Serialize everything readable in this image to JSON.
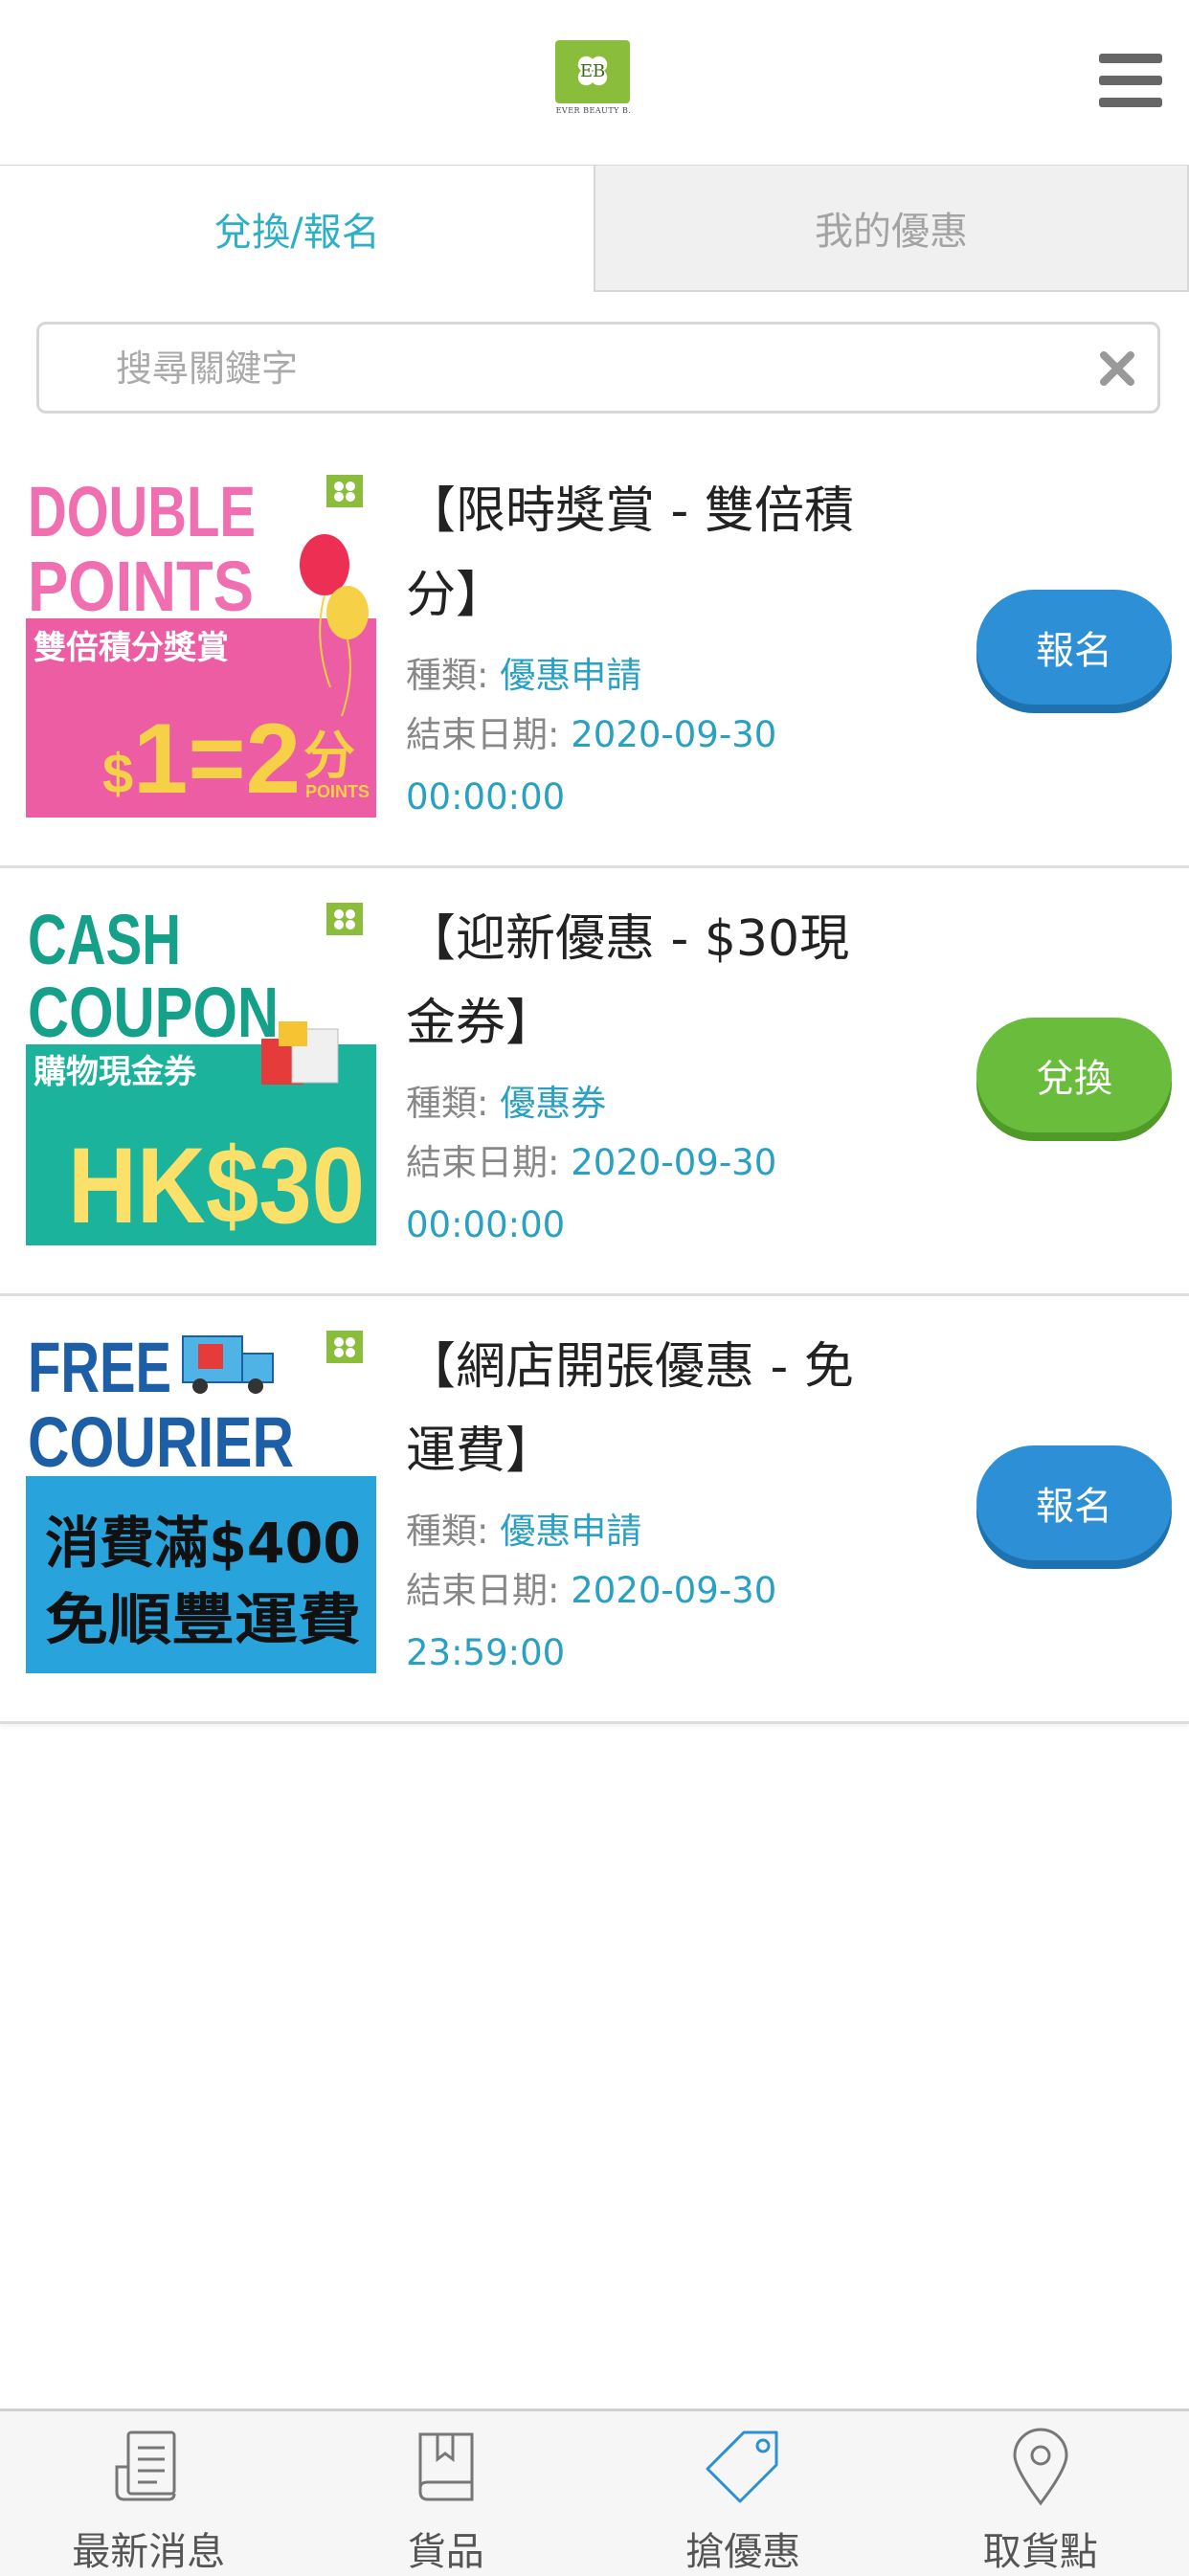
{
  "header": {
    "logo_mark": "EB",
    "logo_text": "EVER BEAUTY B.",
    "menu_icon": "hamburger-icon"
  },
  "tabs": [
    {
      "label": "兌換/報名",
      "active": true
    },
    {
      "label": "我的優惠",
      "active": false
    }
  ],
  "search": {
    "placeholder": "搜尋關鍵字",
    "value": "",
    "clear_icon": "clear-icon"
  },
  "offers": [
    {
      "title": "【限時獎賞 - 雙倍積分】",
      "kind_label": "種類:",
      "kind_value": "優惠申請",
      "date_label": "結束日期:",
      "date_value": "2020-09-30 00:00:00",
      "button_label": "報名",
      "button_color": "#2d8fd6",
      "banner": {
        "line1": "DOUBLE",
        "line2": "POINTS",
        "subtitle": "雙倍積分獎賞",
        "dollar": "$",
        "equation": "1=2",
        "unit": "分",
        "unit_sub": "POINTS"
      }
    },
    {
      "title": "【迎新優惠 - $30現金券】",
      "kind_label": "種類:",
      "kind_value": "優惠券",
      "date_label": "結束日期:",
      "date_value": "2020-09-30 00:00:00",
      "button_label": "兌換",
      "button_color": "#6abd3c",
      "banner": {
        "line1": "CASH",
        "line2": "COUPON",
        "subtitle": "購物現金券",
        "amount": "HK$30"
      }
    },
    {
      "title": "【網店開張優惠 - 免運費】",
      "kind_label": "種類:",
      "kind_value": "優惠申請",
      "date_label": "結束日期:",
      "date_value": "2020-09-30 23:59:00",
      "button_label": "報名",
      "button_color": "#2d8fd6",
      "banner": {
        "line1": "FREE",
        "line2": "COURIER",
        "subtitle1": "消費滿$400",
        "subtitle2": "免順豐運費"
      }
    }
  ],
  "bottom_nav": [
    {
      "label": "最新消息",
      "icon": "news-icon",
      "active": false
    },
    {
      "label": "貨品",
      "icon": "book-icon",
      "active": false
    },
    {
      "label": "搶優惠",
      "icon": "tag-icon",
      "active": true
    },
    {
      "label": "取貨點",
      "icon": "location-pin-icon",
      "active": false
    }
  ],
  "colors": {
    "accent": "#2db0c5",
    "link": "#2aa0c2",
    "button_blue": "#2d8fd6",
    "button_green": "#6abd3c",
    "nav_active": "#2d8fd6"
  }
}
